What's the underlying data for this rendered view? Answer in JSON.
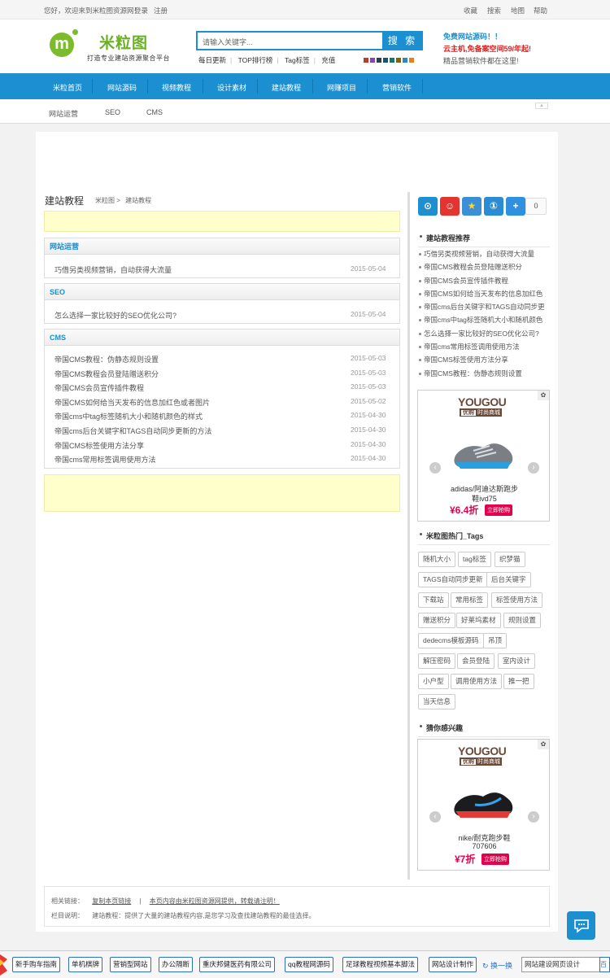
{
  "topbar": {
    "welcome": "您好，欢迎来到米粒图资源网！",
    "login": "登录",
    "register": "注册",
    "favorite": "收藏",
    "search": "搜索",
    "map": "地图",
    "help": "帮助"
  },
  "header": {
    "logo_text": "米粒图",
    "logo_sub": "打造专业建站资源聚合平台",
    "search_placeholder": "请输入关键字...",
    "search_button": "搜 索",
    "hotlinks": [
      "每日更新",
      "TOP排行榜",
      "Tag标签",
      "充值"
    ],
    "swatch_colors": [
      "#c0392b",
      "#8e44ad",
      "#2c3e50",
      "#1a5276",
      "#117a65",
      "#7d6608",
      "#2e86c1",
      "#e67e22"
    ],
    "promo1": "免费网站源码！！",
    "promo2": "云主机,免备案空间59/年起!",
    "promo3": "精品营销软件都在这里!"
  },
  "nav": {
    "items": [
      "米粒首页",
      "网站源码",
      "视频教程",
      "设计素材",
      "建站教程",
      "网赚项目",
      "营销软件"
    ],
    "sub_items": [
      "网站运营",
      "SEO",
      "CMS"
    ]
  },
  "main": {
    "title": "建站教程",
    "breadcrumb": [
      "米粒图",
      ">",
      "建站教程"
    ],
    "sections": [
      {
        "title": "网站运营",
        "rows": [
          {
            "text": "巧借另类视频营销，自动获得大流量",
            "date": "2015-05-04"
          }
        ]
      },
      {
        "title": "SEO",
        "rows": [
          {
            "text": "怎么选择一家比较好的SEO优化公司?",
            "date": "2015-05-04"
          }
        ]
      },
      {
        "title": "CMS",
        "rows": [
          {
            "text": "帝国CMS教程：伪静态规则设置",
            "date": "2015-05-03"
          },
          {
            "text": "帝国CMS教程会员登陆赠送积分",
            "date": "2015-05-03"
          },
          {
            "text": "帝国CMS会员宣传插件教程",
            "date": "2015-05-03"
          },
          {
            "text": "帝国CMS如何给当天发布的信息加红色或者图片",
            "date": "2015-05-02"
          },
          {
            "text": "帝国cms中tag标签随机大小和随机颜色的样式",
            "date": "2015-04-30"
          },
          {
            "text": "帝国cms后台关键字和TAGS自动同步更新的方法",
            "date": "2015-04-30"
          },
          {
            "text": "帝国CMS标签使用方法分享",
            "date": "2015-04-30"
          },
          {
            "text": "帝国cms常用标签调用使用方法",
            "date": "2015-04-30"
          }
        ]
      }
    ]
  },
  "sidebar": {
    "share_count": "0",
    "recommend_title": "建站教程推荐",
    "recommend": [
      "巧借另类视频营销，自动获得大流量",
      "帝国CMS教程会员登陆赠送积分",
      "帝国CMS会员宣传插件教程",
      "帝国CMS如何给当天发布的信息加红色",
      "帝国cms后台关键字和TAGS自动同步更",
      "帝国cms中tag标签随机大小和随机颜色",
      "怎么选择一家比较好的SEO优化公司?",
      "帝国cms常用标签调用使用方法",
      "帝国CMS标签使用方法分享",
      "帝国CMS教程：伪静态规则设置"
    ],
    "ad1": {
      "brand": "YOUGOU",
      "brand_cn": "优购",
      "brand_tag": "时尚商城",
      "name": "adidas/阿迪达斯跑步",
      "name2": "鞋ivd75",
      "price": "¥6.4折",
      "buy": "立即抢购"
    },
    "tags_title": "米粒图热门_Tags",
    "tags": [
      "随机大小",
      "tag标签",
      "织梦猫",
      "TAGS自动同步更新",
      "后台关键字",
      "下载站",
      "常用标签",
      "标签使用方法",
      "赠送积分",
      "好莱坞素材",
      "规则设置",
      "dedecms模板源码",
      "吊顶",
      "解压密码",
      "会员登陆",
      "室内设计",
      "小户型",
      "调用使用方法",
      "推一把",
      "当天信息"
    ],
    "interest_title": "猜你感兴趣",
    "ad2": {
      "brand": "YOUGOU",
      "brand_cn": "优购",
      "brand_tag": "时尚商城",
      "name": "nike/耐克跑步鞋",
      "name2": "707606",
      "price": "¥7折",
      "buy": "立即抢购"
    }
  },
  "footer": {
    "links_label": "相关链接：",
    "link1": "复制本页链接",
    "sep": "|",
    "link2": "本页内容由米粒图资源网提供，转载请注明！",
    "desc_label": "栏目说明：",
    "desc": "建站教程：提供了大量的建站教程内容,是您学习及查找建站教程的最佳选择。"
  },
  "bottombar": {
    "items": [
      "新手购车指南",
      "单机棋牌",
      "营销型网站",
      "办公隔断",
      "重庆邦健医药有限公司",
      "qq教程网源码",
      "足球教程视频基本脚法",
      "网站设计制作"
    ],
    "swap": "换一换",
    "input": "网站建设网页设计",
    "button": "百度"
  }
}
